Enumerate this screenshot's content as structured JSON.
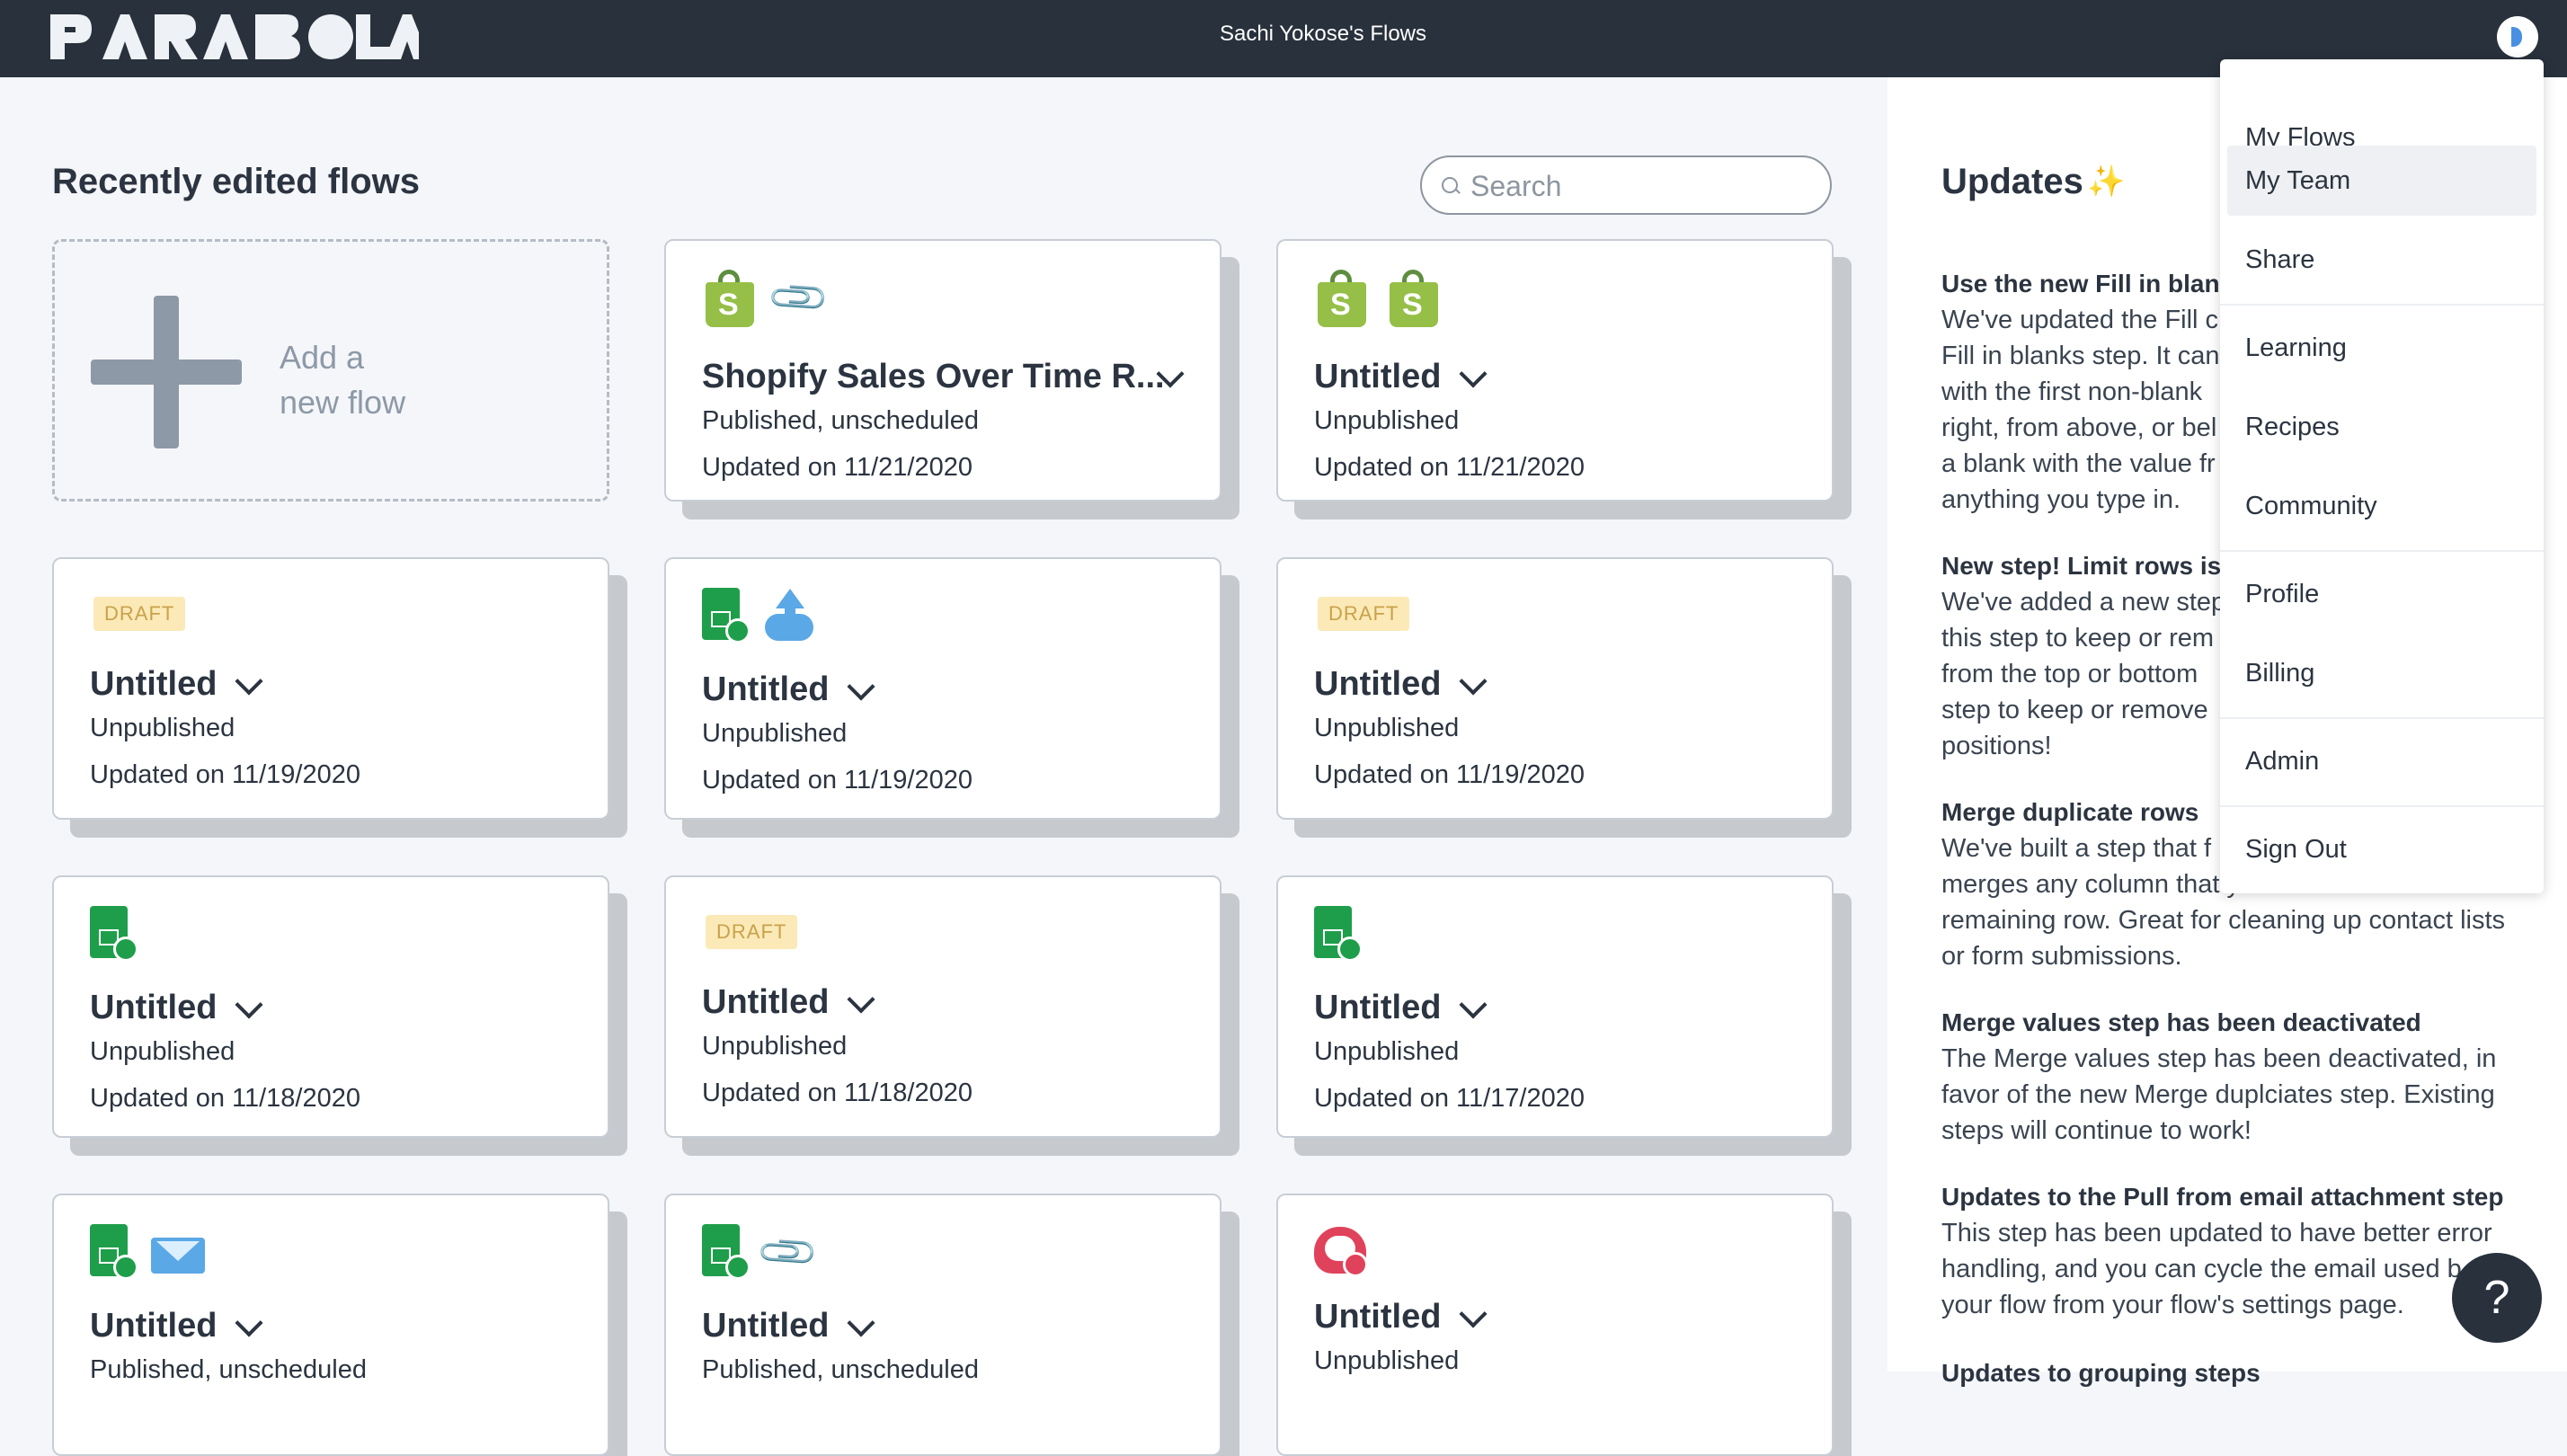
{
  "header": {
    "title": "Sachi Yokose's Flows",
    "logo_text": "PARABOLA"
  },
  "main": {
    "section_title": "Recently edited flows",
    "search_placeholder": "Search",
    "add_flow": {
      "line1": "Add a",
      "line2": "new flow"
    },
    "draft_label": "DRAFT",
    "cards": [
      {
        "title": "Shopify Sales Over Time R...",
        "status": "Published, unscheduled",
        "updated": "Updated on 11/21/2020",
        "icons": [
          "shopify-icon",
          "paperclip-icon"
        ]
      },
      {
        "title": "Untitled",
        "status": "Unpublished",
        "updated": "Updated on 11/21/2020",
        "icons": [
          "shopify-icon",
          "shopify-icon"
        ]
      },
      {
        "title": "Untitled",
        "status": "Unpublished",
        "updated": "Updated on 11/19/2020",
        "draft": true
      },
      {
        "title": "Untitled",
        "status": "Unpublished",
        "updated": "Updated on 11/19/2020",
        "icons": [
          "spreadsheet-import-icon",
          "cloud-upload-icon"
        ]
      },
      {
        "title": "Untitled",
        "status": "Unpublished",
        "updated": "Updated on 11/19/2020",
        "draft": true
      },
      {
        "title": "Untitled",
        "status": "Unpublished",
        "updated": "Updated on 11/18/2020",
        "icons": [
          "spreadsheet-import-icon"
        ]
      },
      {
        "title": "Untitled",
        "status": "Unpublished",
        "updated": "Updated on 11/18/2020",
        "draft": true
      },
      {
        "title": "Untitled",
        "status": "Unpublished",
        "updated": "Updated on 11/17/2020",
        "icons": [
          "spreadsheet-import-icon"
        ]
      },
      {
        "title": "Untitled",
        "status": "Published, unscheduled",
        "icons": [
          "spreadsheet-import-icon",
          "email-icon"
        ]
      },
      {
        "title": "Untitled",
        "status": "Published, unscheduled",
        "icons": [
          "spreadsheet-import-icon",
          "paperclip-icon"
        ]
      },
      {
        "title": "Untitled",
        "status": "Unpublished",
        "icons": [
          "heart-import-icon"
        ]
      }
    ]
  },
  "updates": {
    "title": "Updates",
    "items": [
      {
        "heading": "Use the new Fill in blank",
        "lines": [
          "We've updated the Fill c",
          "Fill in blanks step. It can",
          "with the first non-blank",
          "right, from above, or bel",
          "a blank with the value fr",
          "anything you type in."
        ]
      },
      {
        "heading": "New step! Limit rows is n",
        "lines": [
          "We've added a new step",
          "this step to keep or rem",
          "from the top or bottom",
          "step to keep or remove",
          "positions!"
        ]
      },
      {
        "heading": "Merge duplicate rows",
        "lines": [
          "We've built a step that f",
          "merges any column that y",
          "remaining row. Great for cleaning up contact lists",
          "or form submissions."
        ]
      },
      {
        "heading": "Merge values step has been deactivated",
        "lines": [
          "The Merge values step has been deactivated, in",
          "favor of the new Merge duplciates step. Existing",
          "steps will continue to work!"
        ]
      },
      {
        "heading": "Updates to the Pull from email attachment step",
        "lines": [
          "This step has been updated to have better error",
          "handling, and you can cycle the email used b",
          "your flow from your flow's settings page."
        ]
      },
      {
        "heading": "Updates to grouping steps",
        "lines": []
      }
    ]
  },
  "menu": {
    "items": [
      "My Flows",
      "My Team",
      "Share",
      "Learning",
      "Recipes",
      "Community",
      "Profile",
      "Billing",
      "Admin",
      "Sign Out"
    ],
    "active": "My Team"
  },
  "help": {
    "label": "?"
  }
}
